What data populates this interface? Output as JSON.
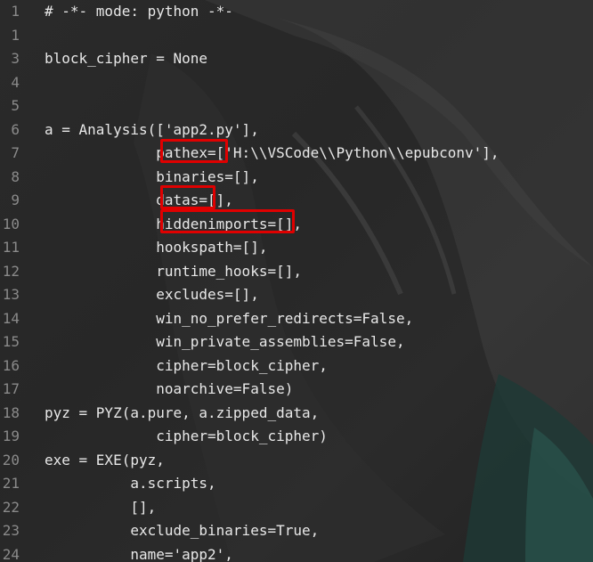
{
  "code_lines": [
    {
      "number": "1",
      "text": "# -*- mode: python -*-"
    },
    {
      "number": "1",
      "text": ""
    },
    {
      "number": "3",
      "text": "block_cipher = None"
    },
    {
      "number": "4",
      "text": ""
    },
    {
      "number": "5",
      "text": ""
    },
    {
      "number": "6",
      "text": "a = Analysis(['app2.py'],"
    },
    {
      "number": "7",
      "text": "             pathex=['H:\\\\VSCode\\\\Python\\\\epubconv'],"
    },
    {
      "number": "8",
      "text": "             binaries=[],"
    },
    {
      "number": "9",
      "text": "             datas=[],"
    },
    {
      "number": "10",
      "text": "             hiddenimports=[],"
    },
    {
      "number": "11",
      "text": "             hookspath=[],"
    },
    {
      "number": "12",
      "text": "             runtime_hooks=[],"
    },
    {
      "number": "13",
      "text": "             excludes=[],"
    },
    {
      "number": "14",
      "text": "             win_no_prefer_redirects=False,"
    },
    {
      "number": "15",
      "text": "             win_private_assemblies=False,"
    },
    {
      "number": "16",
      "text": "             cipher=block_cipher,"
    },
    {
      "number": "17",
      "text": "             noarchive=False)"
    },
    {
      "number": "18",
      "text": "pyz = PYZ(a.pure, a.zipped_data,"
    },
    {
      "number": "19",
      "text": "             cipher=block_cipher)"
    },
    {
      "number": "20",
      "text": "exe = EXE(pyz,"
    },
    {
      "number": "21",
      "text": "          a.scripts,"
    },
    {
      "number": "22",
      "text": "          [],"
    },
    {
      "number": "23",
      "text": "          exclude_binaries=True,"
    },
    {
      "number": "24",
      "text": "          name='app2',"
    }
  ],
  "highlight_color": "#e00000"
}
